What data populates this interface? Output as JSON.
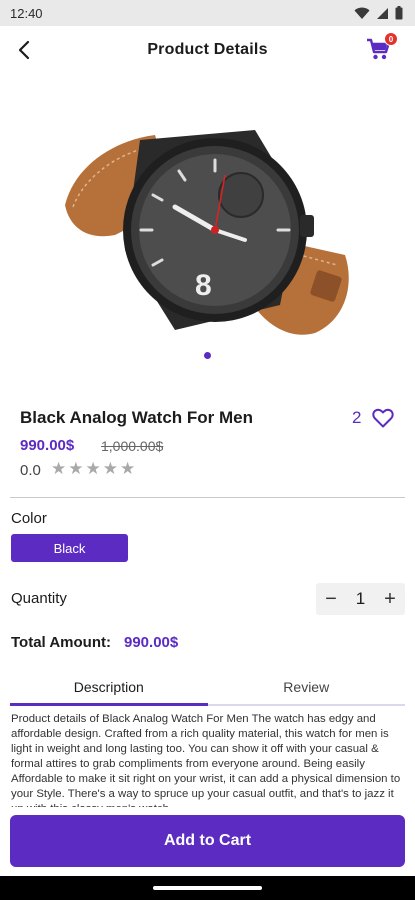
{
  "status_bar": {
    "time": "12:40"
  },
  "header": {
    "title": "Product Details",
    "cart_count": "0"
  },
  "product": {
    "name": "Black Analog Watch For Men",
    "price": "990.00$",
    "old_price": "1,000.00$",
    "rating": "0.0",
    "stars": 5,
    "favorites": "2",
    "image_icon": "watch-image"
  },
  "options": {
    "color_label": "Color",
    "color_value": "Black",
    "quantity_label": "Quantity",
    "quantity": "1",
    "minus_symbol": "−",
    "plus_symbol": "+"
  },
  "total": {
    "label": "Total Amount:",
    "value": "990.00$"
  },
  "tabs": [
    {
      "label": "Description",
      "active": true
    },
    {
      "label": "Review",
      "active": false
    }
  ],
  "description": "Product details of Black Analog Watch For Men The watch has edgy and affordable design. Crafted from a rich quality material, this watch for men is light in weight and long lasting too. You can show it off with your casual & formal attires to grab compliments from everyone around. Being easily Affordable to make it sit right on your wrist, it can add a physical dimension to your Style. There's a way to spruce up your casual outfit, and that's to jazz it up with this classy men's watch",
  "actions": {
    "add_to_cart": "Add to Cart"
  },
  "colors": {
    "accent": "#5b2bc2",
    "badge": "#e5322d",
    "star_inactive": "#a9a9a9"
  }
}
